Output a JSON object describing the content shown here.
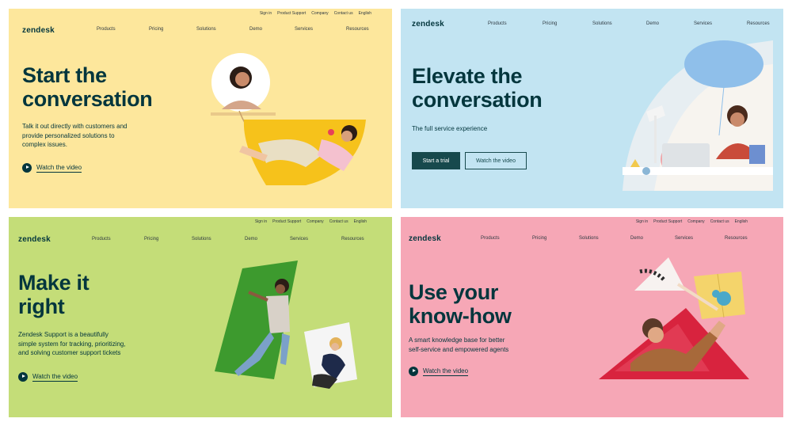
{
  "colors": {
    "yellow_bg": "#fde79c",
    "blue_bg": "#c2e4f2",
    "green_bg": "#c4dd78",
    "pink_bg": "#f6a7b6",
    "ink": "#03363d",
    "button": "#17494d"
  },
  "utility_links": [
    "Sign in",
    "Product Support",
    "Company",
    "Contact us",
    "English"
  ],
  "nav_items": [
    "Products",
    "Pricing",
    "Solutions",
    "Demo",
    "Services",
    "Resources"
  ],
  "logo": "zendesk",
  "panels": {
    "p1": {
      "line1": "Start the",
      "line2": "conversation",
      "body1": "Talk it out directly with customers and",
      "body2": "provide personalized solutions to",
      "body3": "complex issues.",
      "watch": "Watch the video"
    },
    "p2": {
      "line1": "Elevate the",
      "line2": "conversation",
      "sub": "The full service experience",
      "primary": "Start a trial",
      "secondary": "Watch the video"
    },
    "p3": {
      "line1": "Make it",
      "line2": "right",
      "body1": "Zendesk Support is a beautifully",
      "body2": "simple system for tracking, prioritizing,",
      "body3": "and solving customer support tickets",
      "watch": "Watch the video"
    },
    "p4": {
      "line1": "Use your",
      "line2": "know-how",
      "body1": "A smart knowledge base for better",
      "body2": "self-service and empowered agents",
      "watch": "Watch the video"
    }
  }
}
